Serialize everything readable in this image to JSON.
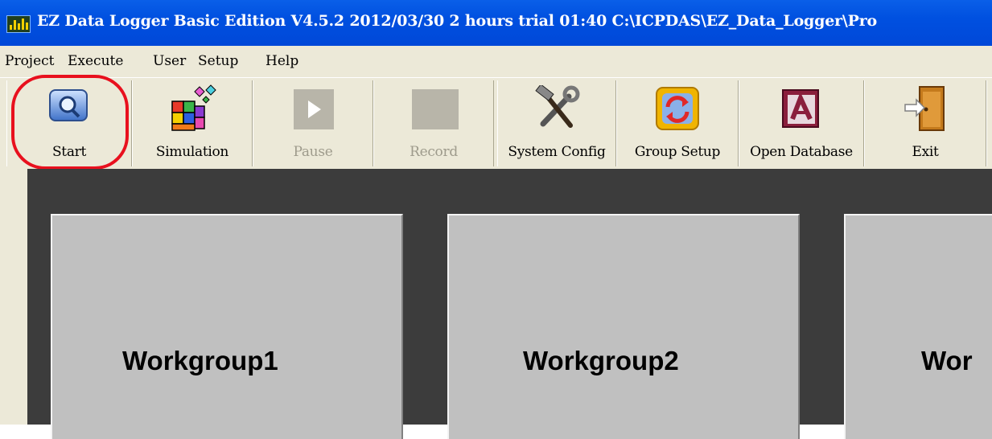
{
  "window": {
    "title": "EZ Data Logger Basic Edition V4.5.2 2012/03/30   2 hours trial  01:40  C:\\ICPDAS\\EZ_Data_Logger\\Pro",
    "app_icon": "chart-icon"
  },
  "menu": [
    "Project",
    "Execute",
    "User",
    "Setup",
    "Help"
  ],
  "toolbar": {
    "start": "Start",
    "simulation": "Simulation",
    "pause": "Pause",
    "record": "Record",
    "system_config": "System Config",
    "group_setup": "Group Setup",
    "open_database": "Open Database",
    "exit": "Exit"
  },
  "workgroups": [
    "Workgroup1",
    "Workgroup2",
    "Wor"
  ],
  "colors": {
    "titlebar": "#0050e0",
    "highlight": "#e8101e",
    "workspace": "#3c3c3c",
    "tile": "#c0c0c0"
  }
}
